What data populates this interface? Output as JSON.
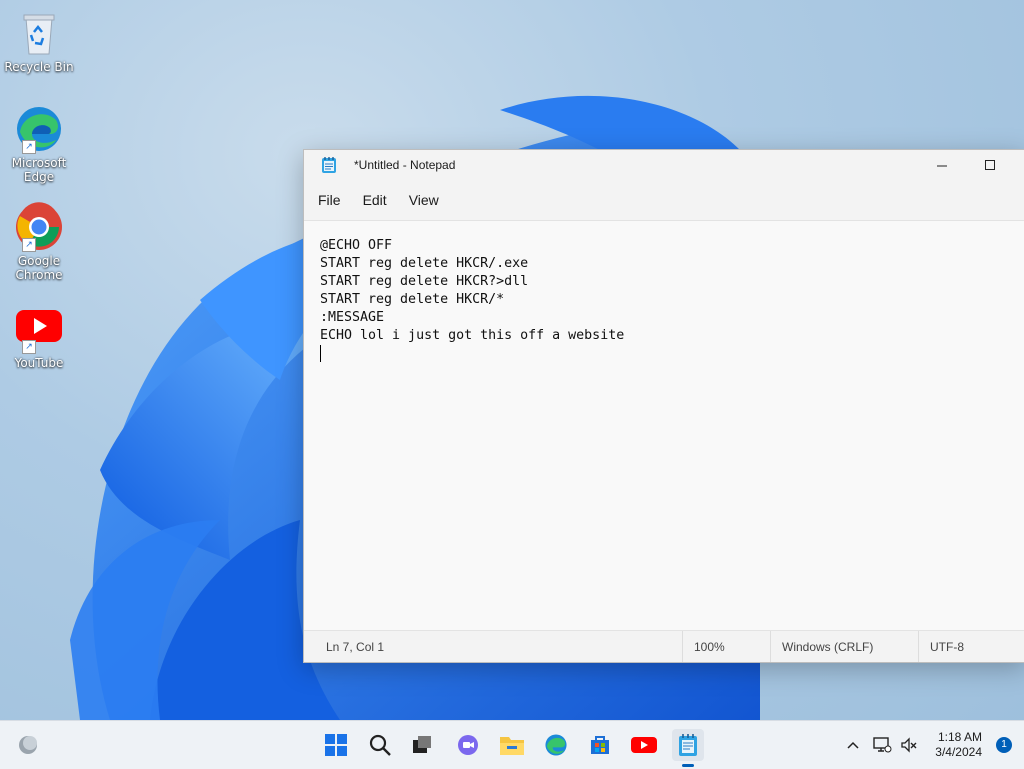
{
  "desktop": {
    "icons": [
      {
        "label": "Recycle Bin",
        "icon": "recycle-bin-icon"
      },
      {
        "label": "Microsoft Edge",
        "icon": "edge-icon"
      },
      {
        "label": "Google Chrome",
        "icon": "chrome-icon"
      },
      {
        "label": "YouTube",
        "icon": "youtube-icon"
      }
    ]
  },
  "notepad": {
    "title": "*Untitled - Notepad",
    "menu": [
      "File",
      "Edit",
      "View"
    ],
    "content_lines": [
      "@ECHO OFF",
      "START reg delete HKCR/.exe",
      "START reg delete HKCR?>dll",
      "START reg delete HKCR/*",
      ":MESSAGE",
      "ECHO lol i just got this off a website"
    ],
    "status": {
      "position": "Ln 7, Col 1",
      "zoom": "100%",
      "line_ending": "Windows (CRLF)",
      "encoding": "UTF-8"
    },
    "controls": {
      "minimize": "minimize-icon",
      "maximize": "maximize-icon"
    }
  },
  "taskbar": {
    "pinned": [
      "start-icon",
      "search-icon",
      "task-view-icon",
      "chat-icon",
      "file-explorer-icon",
      "edge-icon",
      "store-icon",
      "youtube-icon",
      "notepad-icon"
    ],
    "active": "notepad-icon",
    "clock": {
      "time": "1:18 AM",
      "date": "3/4/2024"
    },
    "notifications": "1"
  },
  "colors": {
    "accent": "#005fb8",
    "wallpaper_blue": "#1e6fe8"
  }
}
